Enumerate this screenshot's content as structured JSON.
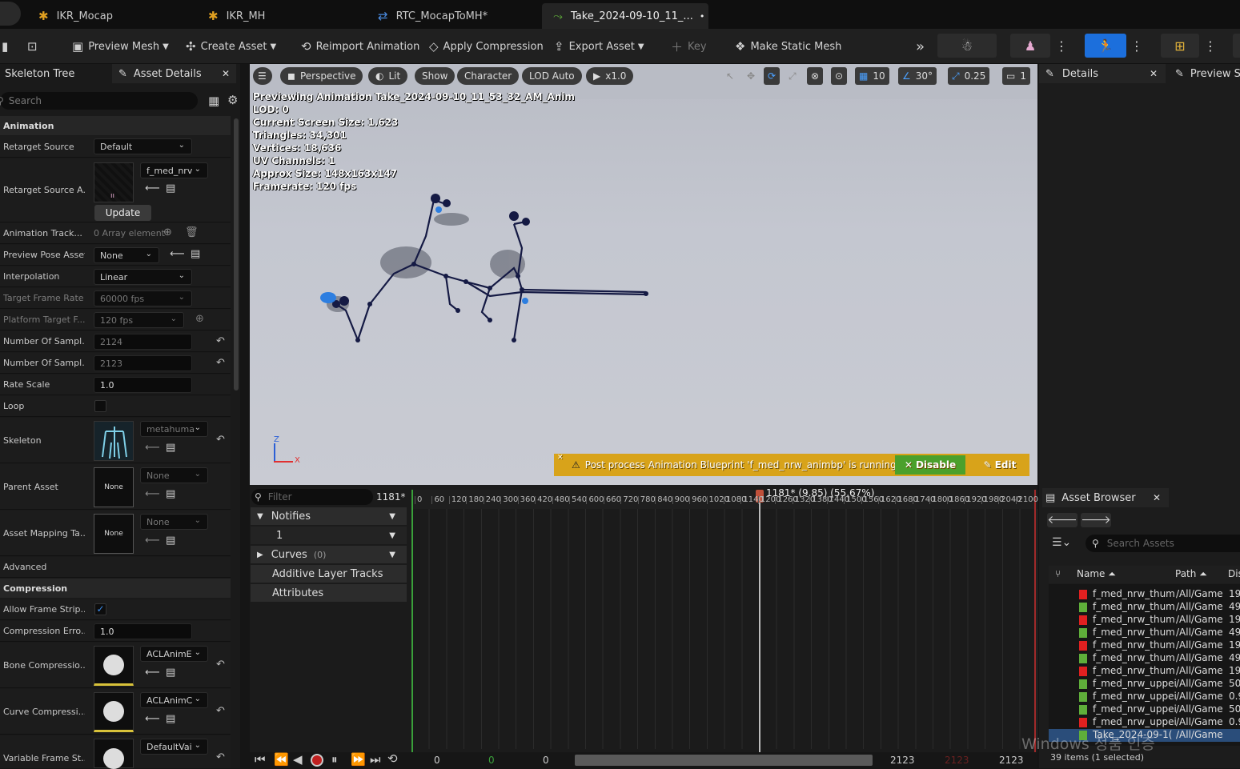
{
  "tabs": [
    {
      "label": "IKR_Mocap",
      "icon": "person-icon",
      "active": false
    },
    {
      "label": "IKR_MH",
      "icon": "person-icon",
      "active": false
    },
    {
      "label": "RTC_MocapToMH*",
      "icon": "retarget-icon",
      "active": false
    },
    {
      "label": "Take_2024-09-10_11_...",
      "icon": "anim-icon",
      "active": true
    }
  ],
  "tab_close": "• ×",
  "toolbar": {
    "preview_mesh": "Preview Mesh",
    "create_asset": "Create Asset",
    "reimport": "Reimport Animation",
    "apply_compression": "Apply Compression",
    "export_asset": "Export Asset",
    "key": "Key",
    "make_static_mesh": "Make Static Mesh"
  },
  "left_panel": {
    "tabs": [
      "Skeleton Tree",
      "Asset Details"
    ],
    "search_placeholder": "Search",
    "sections": {
      "animation": "Animation",
      "compression": "Compression",
      "advanced": "Advanced"
    },
    "props": {
      "retarget_source": {
        "label": "Retarget Source",
        "value": "Default"
      },
      "retarget_source_asset": {
        "label": "Retarget Source A...",
        "value": "f_med_nrv",
        "button": "Update"
      },
      "animation_track": {
        "label": "Animation Track...",
        "value": "0 Array element"
      },
      "preview_pose_asset": {
        "label": "Preview Pose Asset",
        "value": "None"
      },
      "interpolation": {
        "label": "Interpolation",
        "value": "Linear"
      },
      "target_frame_rate": {
        "label": "Target Frame Rate",
        "value": "60000 fps"
      },
      "platform_target": {
        "label": "Platform Target F...",
        "value": "120 fps"
      },
      "num_samples_1": {
        "label": "Number Of Sampl...",
        "value": "2124"
      },
      "num_samples_2": {
        "label": "Number Of Sampl...",
        "value": "2123"
      },
      "rate_scale": {
        "label": "Rate Scale",
        "value": "1.0"
      },
      "loop": {
        "label": "Loop"
      },
      "skeleton": {
        "label": "Skeleton",
        "value": "metahuma"
      },
      "parent_asset": {
        "label": "Parent Asset",
        "value": "None",
        "thumb": "None"
      },
      "asset_mapping": {
        "label": "Asset Mapping Ta...",
        "value": "None",
        "thumb": "None"
      },
      "allow_frame_strip": {
        "label": "Allow Frame Strip..."
      },
      "compression_error": {
        "label": "Compression Erro...",
        "value": "1.0"
      },
      "bone_compression": {
        "label": "Bone Compressio...",
        "value": "ACLAnimE"
      },
      "curve_compression": {
        "label": "Curve Compressi...",
        "value": "ACLAnimC"
      },
      "variable_frame": {
        "label": "Variable Frame St...",
        "value": "DefaultVai"
      }
    }
  },
  "viewport": {
    "buttons": {
      "perspective": "Perspective",
      "lit": "Lit",
      "show": "Show",
      "character": "Character",
      "lod": "LOD Auto",
      "speed": "x1.0"
    },
    "right_controls": {
      "grid": "10",
      "angle": "30°",
      "scale": "0.25",
      "camera": "1"
    },
    "stats": [
      "Previewing Animation Take_2024-09-10_11_53_32_AM_Anim",
      "LOD: 0",
      "Current Screen Size: 1.623",
      "Triangles: 34,301",
      "Vertices: 18,636",
      "UV Channels: 1",
      "Approx Size: 148x163x147",
      "Framerate: 120 fps"
    ],
    "warning": "Post process Animation Blueprint 'f_med_nrw_animbp' is running.",
    "disable": "Disable",
    "edit": "Edit",
    "axis_z": "Z",
    "axis_x": "X"
  },
  "details_panel": {
    "title": "Details"
  },
  "preview_panel": {
    "title": "Preview S"
  },
  "timeline": {
    "filter_placeholder": "Filter",
    "frame": "1181*",
    "tracks": {
      "notifies": "Notifies",
      "notify_track": "1",
      "curves": "Curves",
      "curves_count": "(0)",
      "additive": "Additive Layer Tracks",
      "attributes": "Attributes"
    },
    "playhead_label": "1181* (9.85) (55.67%)",
    "ruler": [
      "0",
      "60",
      "120",
      "180",
      "240",
      "300",
      "360",
      "420",
      "480",
      "540",
      "600",
      "660",
      "720",
      "780",
      "840",
      "900",
      "960",
      "1020",
      "1080",
      "1140",
      "1200",
      "1260",
      "1320",
      "1380",
      "1440",
      "1500",
      "1560",
      "1620",
      "1680",
      "1740",
      "1800",
      "1860",
      "1920",
      "1980",
      "2040",
      "2100"
    ],
    "bottom": {
      "start": "0",
      "green": "0",
      "mid": "0",
      "end": "2123",
      "red": "2123",
      "end2": "2123"
    }
  },
  "asset_browser": {
    "title": "Asset Browser",
    "search_placeholder": "Search Assets",
    "columns": {
      "name": "Name",
      "path": "Path",
      "dis": "Dis"
    },
    "rows": [
      {
        "name": "f_med_nrw_thum",
        "path": "/All/Game",
        "val": "19",
        "color": "#e02020"
      },
      {
        "name": "f_med_nrw_thum",
        "path": "/All/Game",
        "val": "49",
        "color": "#5fae3a"
      },
      {
        "name": "f_med_nrw_thum",
        "path": "/All/Game",
        "val": "19",
        "color": "#e02020"
      },
      {
        "name": "f_med_nrw_thum",
        "path": "/All/Game",
        "val": "49",
        "color": "#5fae3a"
      },
      {
        "name": "f_med_nrw_thum",
        "path": "/All/Game",
        "val": "19",
        "color": "#e02020"
      },
      {
        "name": "f_med_nrw_thum",
        "path": "/All/Game",
        "val": "49",
        "color": "#5fae3a"
      },
      {
        "name": "f_med_nrw_thum",
        "path": "/All/Game",
        "val": "19",
        "color": "#e02020"
      },
      {
        "name": "f_med_nrw_uppei",
        "path": "/All/Game",
        "val": "50",
        "color": "#5fae3a"
      },
      {
        "name": "f_med_nrw_uppei",
        "path": "/All/Game",
        "val": "0.9",
        "color": "#5fae3a"
      },
      {
        "name": "f_med_nrw_uppei",
        "path": "/All/Game",
        "val": "50",
        "color": "#5fae3a"
      },
      {
        "name": "f_med_nrw_uppei",
        "path": "/All/Game",
        "val": "0.9",
        "color": "#e02020"
      },
      {
        "name": "Take_2024-09-1(",
        "path": "/All/Game",
        "val": "",
        "color": "#5fae3a"
      }
    ],
    "status": "39 items (1 selected)"
  },
  "watermark": "Windows 정품 인증"
}
